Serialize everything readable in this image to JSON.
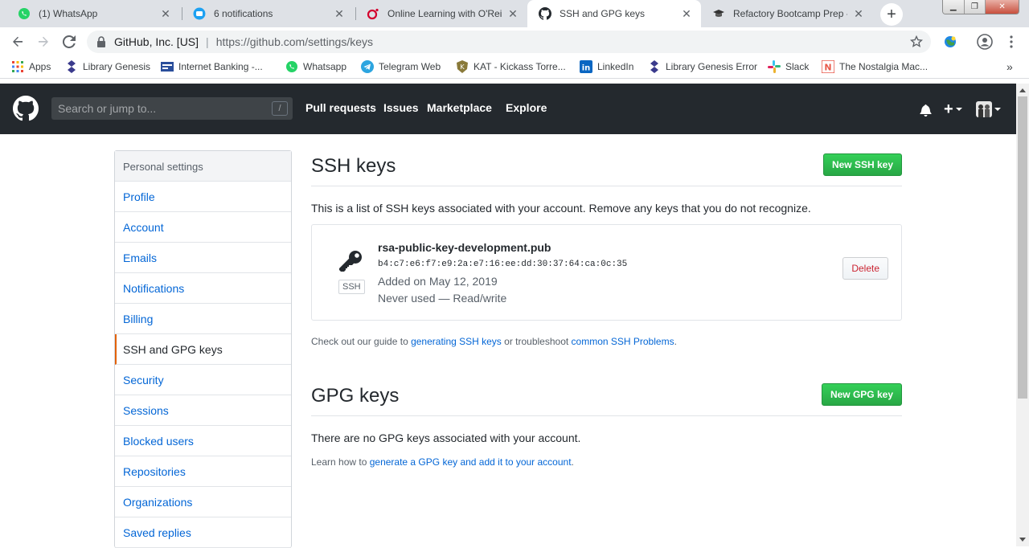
{
  "browser": {
    "tabs": [
      {
        "title": "(1) WhatsApp",
        "icon": "whatsapp-icon"
      },
      {
        "title": "6 notifications",
        "icon": "chat-icon"
      },
      {
        "title": "Online Learning with O'Reilly",
        "icon": "oreilly-icon"
      },
      {
        "title": "SSH and GPG keys",
        "icon": "github-icon",
        "active": true
      },
      {
        "title": "Refactory Bootcamp Prep - C",
        "icon": "graduation-cap-icon"
      }
    ],
    "omnibox": {
      "site": "GitHub, Inc. [US]",
      "url": "https://github.com/settings/keys"
    },
    "bookmarks": [
      {
        "label": "Apps",
        "icon": "apps-grid-icon"
      },
      {
        "label": "Library Genesis",
        "icon": "libgen-icon"
      },
      {
        "label": "Internet Banking -...",
        "icon": "bank-icon"
      },
      {
        "label": "Whatsapp",
        "icon": "whatsapp-icon"
      },
      {
        "label": "Telegram Web",
        "icon": "telegram-icon"
      },
      {
        "label": "KAT - Kickass Torre...",
        "icon": "kat-icon"
      },
      {
        "label": "LinkedIn",
        "icon": "linkedin-icon"
      },
      {
        "label": "Library Genesis Error",
        "icon": "libgen-icon"
      },
      {
        "label": "Slack",
        "icon": "slack-icon"
      },
      {
        "label": "The Nostalgia Mac...",
        "icon": "nostalgia-icon"
      }
    ],
    "more_bookmarks": "»"
  },
  "header": {
    "search_placeholder": "Search or jump to...",
    "search_shortcut": "/",
    "nav": [
      "Pull requests",
      "Issues",
      "Marketplace",
      "Explore"
    ],
    "new_menu": "+"
  },
  "sidebar": {
    "heading": "Personal settings",
    "items": [
      {
        "label": "Profile"
      },
      {
        "label": "Account"
      },
      {
        "label": "Emails"
      },
      {
        "label": "Notifications"
      },
      {
        "label": "Billing"
      },
      {
        "label": "SSH and GPG keys",
        "selected": true
      },
      {
        "label": "Security"
      },
      {
        "label": "Sessions"
      },
      {
        "label": "Blocked users"
      },
      {
        "label": "Repositories"
      },
      {
        "label": "Organizations"
      },
      {
        "label": "Saved replies"
      }
    ]
  },
  "ssh": {
    "title": "SSH keys",
    "new_button": "New SSH key",
    "description": "This is a list of SSH keys associated with your account. Remove any keys that you do not recognize.",
    "key": {
      "badge": "SSH",
      "name": "rsa-public-key-development.pub",
      "fingerprint": "b4:c7:e6:f7:e9:2a:e7:16:ee:dd:30:37:64:ca:0c:35",
      "added": "Added on May 12, 2019",
      "usage": "Never used — Read/write",
      "delete_label": "Delete"
    },
    "guide_prefix": "Check out our guide to ",
    "guide_link1": "generating SSH keys",
    "guide_middle": " or troubleshoot ",
    "guide_link2": "common SSH Problems",
    "guide_suffix": "."
  },
  "gpg": {
    "title": "GPG keys",
    "new_button": "New GPG key",
    "description": "There are no GPG keys associated with your account.",
    "learn_prefix": "Learn how to ",
    "learn_link": "generate a GPG key and add it to your account",
    "learn_suffix": "."
  },
  "colors": {
    "header_bg": "#24292e",
    "link": "#0366d6",
    "green_button": "#28a745",
    "danger": "#cb2431",
    "selected_accent": "#e36209"
  }
}
